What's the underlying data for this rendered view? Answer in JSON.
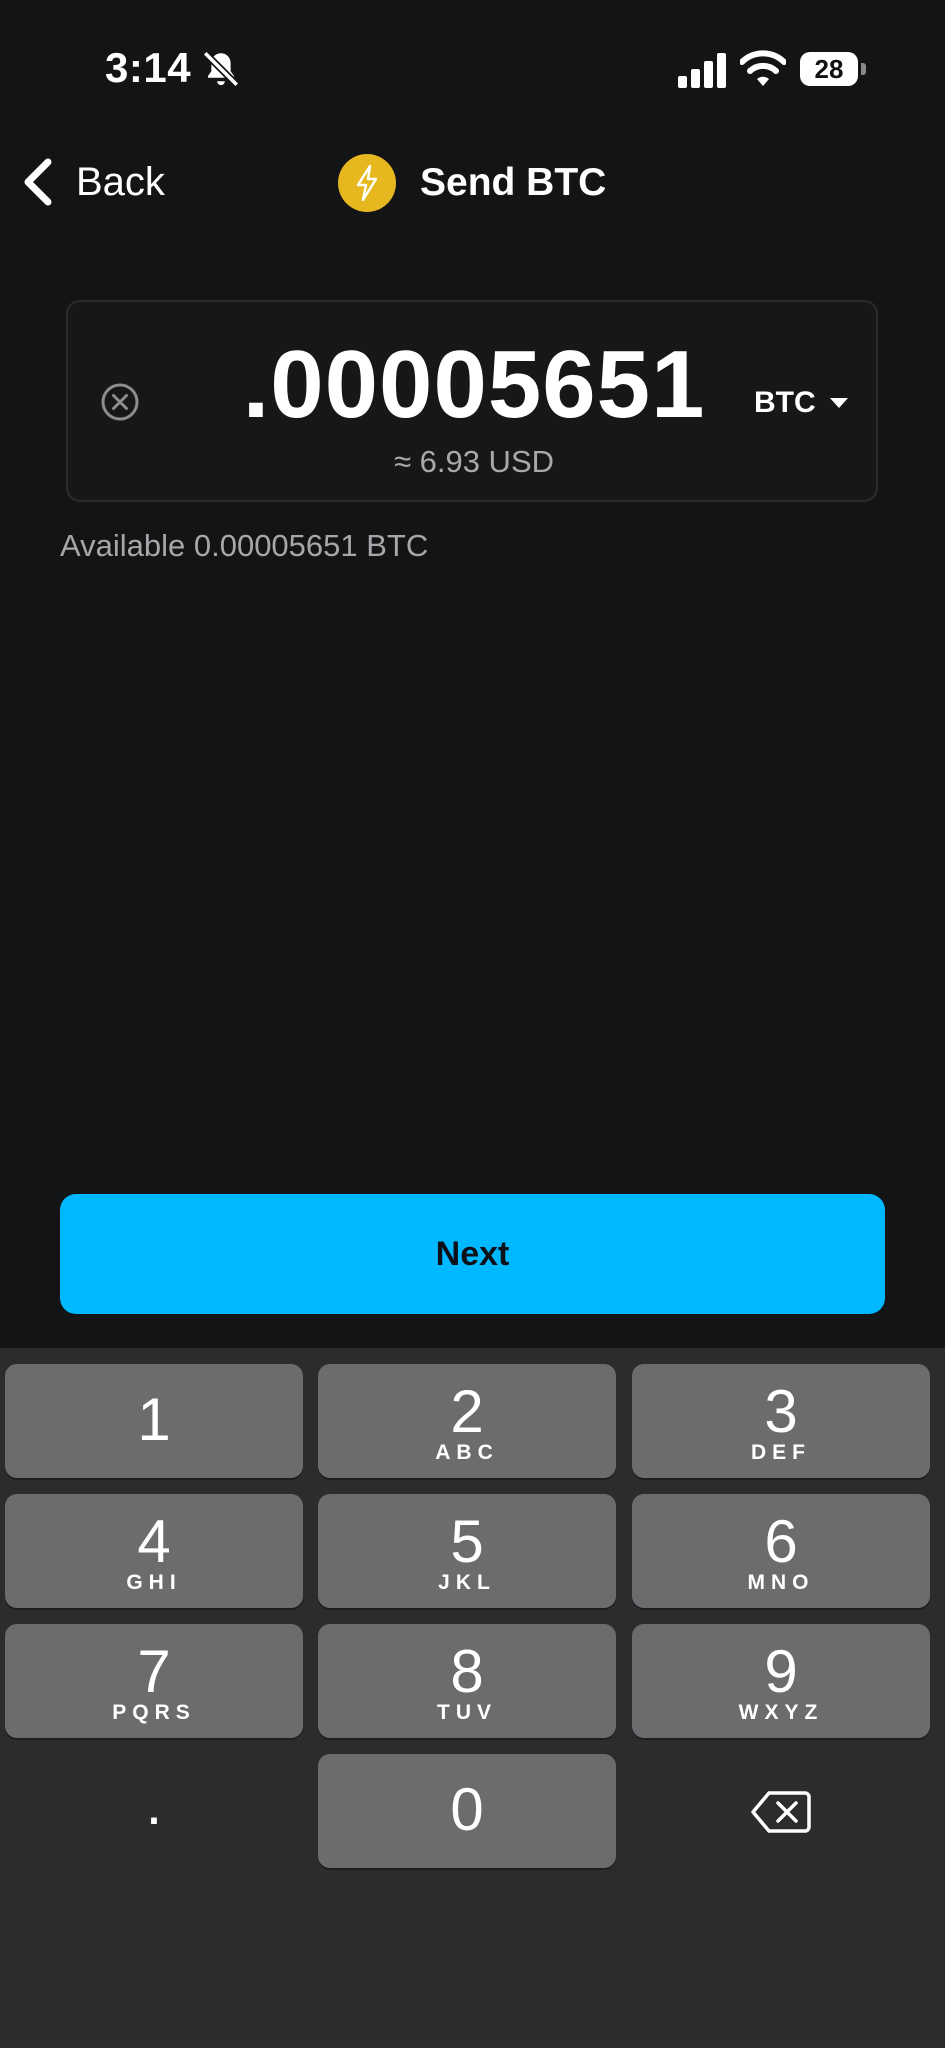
{
  "status_bar": {
    "time": "3:14",
    "battery": "28"
  },
  "nav": {
    "back_label": "Back",
    "title": "Send BTC"
  },
  "amount": {
    "value": ".00005651",
    "unit": "BTC",
    "fiat_estimate": "≈ 6.93 USD"
  },
  "available_text": "Available 0.00005651 BTC",
  "next_label": "Next",
  "keypad": {
    "k1": {
      "digit": "1",
      "letters": ""
    },
    "k2": {
      "digit": "2",
      "letters": "ABC"
    },
    "k3": {
      "digit": "3",
      "letters": "DEF"
    },
    "k4": {
      "digit": "4",
      "letters": "GHI"
    },
    "k5": {
      "digit": "5",
      "letters": "JKL"
    },
    "k6": {
      "digit": "6",
      "letters": "MNO"
    },
    "k7": {
      "digit": "7",
      "letters": "PQRS"
    },
    "k8": {
      "digit": "8",
      "letters": "TUV"
    },
    "k9": {
      "digit": "9",
      "letters": "WXYZ"
    },
    "k0": {
      "digit": "0",
      "letters": ""
    },
    "decimal": "."
  },
  "colors": {
    "background": "#131416",
    "accent": "#00b8ff",
    "coin": "#e6b71e",
    "key": "#6b6c6e",
    "keypad_bg": "#2b2c2e"
  },
  "icons": [
    "bell-slash-icon",
    "cellular-signal-icon",
    "wifi-icon",
    "battery-icon",
    "chevron-left-icon",
    "lightning-bolt-icon",
    "clear-circle-icon",
    "caret-down-icon",
    "backspace-icon"
  ]
}
